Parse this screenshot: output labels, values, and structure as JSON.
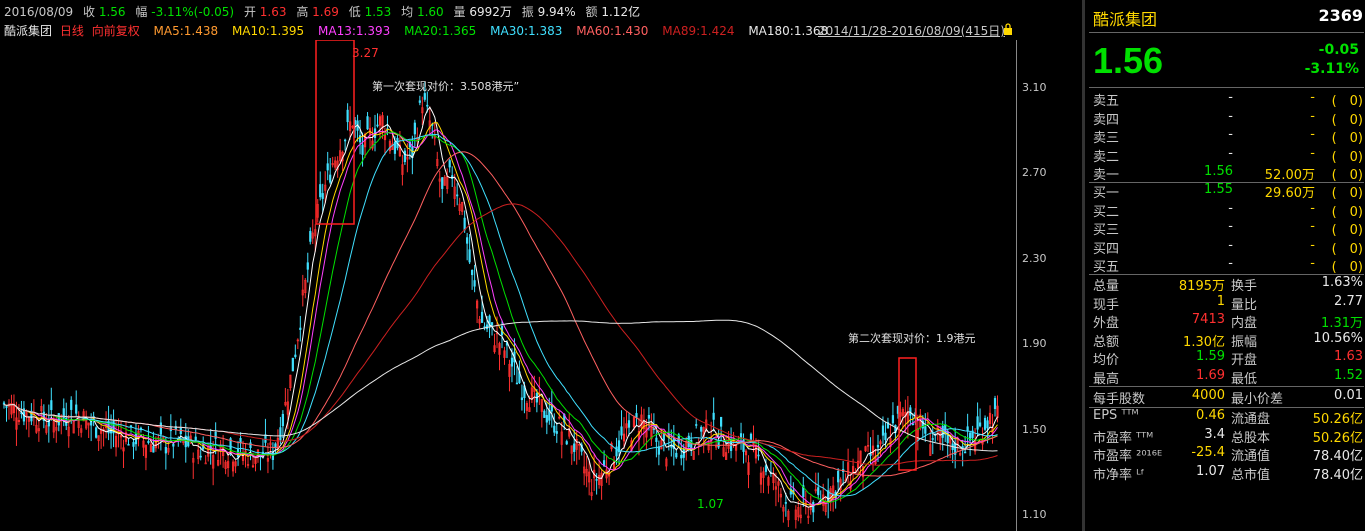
{
  "header": {
    "date": "2016/08/09",
    "close_label": "收",
    "close": "1.56",
    "change_label": "幅",
    "change": "-3.11%(-0.05)",
    "open_label": "开",
    "open": "1.63",
    "high_label": "高",
    "high": "1.69",
    "low_label": "低",
    "low": "1.53",
    "avg_label": "均",
    "avg": "1.60",
    "volume_label": "量",
    "volume": "6992万",
    "amplitude_label": "振",
    "amplitude": "9.94%",
    "amount_label": "额",
    "amount": "1.12亿"
  },
  "ma_row": {
    "name": "酷派集团",
    "period": "日线",
    "adjust": "向前复权",
    "ma5": "MA5:1.438",
    "ma10": "MA10:1.395",
    "ma13": "MA13:1.393",
    "ma20": "MA20:1.365",
    "ma30": "MA30:1.383",
    "ma60": "MA60:1.430",
    "ma89": "MA89:1.424",
    "ma180": "MA180:1.368",
    "range": "2014/11/28-2016/08/09(415日)"
  },
  "colors": {
    "up": "#ff3030",
    "down": "#00e000",
    "ma5": "#ffffff",
    "ma10": "#ffd800",
    "ma13": "#ff40ff",
    "ma20": "#00e000",
    "ma30": "#40e0ff",
    "ma60": "#ff6060",
    "ma89": "#cc2020",
    "ma180": "#e8e8e8",
    "box": "#ff2020"
  },
  "annotations": {
    "peak": "3.27",
    "low": "1.07",
    "first_sale": "第一次套现对价：3.508港元”",
    "second_sale": "第二次套现对价：1.9港元"
  },
  "chart_data": {
    "type": "candlestick",
    "ylim": [
      1.05,
      3.3
    ],
    "y_ticks": [
      "3.10",
      "2.70",
      "2.30",
      "1.90",
      "1.50",
      "1.10"
    ],
    "y_tick_values": [
      3.1,
      2.7,
      2.3,
      1.9,
      1.5,
      1.1
    ],
    "x_range": [
      "2014/11/28",
      "2016/08/09"
    ],
    "close_series": [
      1.62,
      1.6,
      1.58,
      1.57,
      1.55,
      1.54,
      1.56,
      1.58,
      1.55,
      1.52,
      1.5,
      1.48,
      1.47,
      1.46,
      1.45,
      1.44,
      1.43,
      1.45,
      1.44,
      1.42,
      1.4,
      1.42,
      1.41,
      1.4,
      1.39,
      1.38,
      1.38,
      1.4,
      1.55,
      1.8,
      2.1,
      2.4,
      2.6,
      2.75,
      2.85,
      2.95,
      2.8,
      2.9,
      2.95,
      2.85,
      2.75,
      2.8,
      3.05,
      2.9,
      2.6,
      2.7,
      2.55,
      2.2,
      2.0,
      1.95,
      1.9,
      1.8,
      1.7,
      1.65,
      1.6,
      1.55,
      1.5,
      1.45,
      1.35,
      1.25,
      1.3,
      1.38,
      1.45,
      1.5,
      1.55,
      1.48,
      1.42,
      1.4,
      1.42,
      1.45,
      1.48,
      1.5,
      1.46,
      1.44,
      1.42,
      1.4,
      1.35,
      1.28,
      1.2,
      1.15,
      1.12,
      1.15,
      1.18,
      1.22,
      1.25,
      1.3,
      1.35,
      1.38,
      1.4,
      1.5,
      1.55,
      1.6,
      1.52,
      1.48,
      1.45,
      1.42,
      1.43,
      1.45,
      1.5,
      1.56
    ]
  },
  "panel": {
    "name": "酷派集团",
    "code": "2369",
    "price": "1.56",
    "change": "-0.05",
    "change_pct": "-3.11%",
    "asks": [
      {
        "label": "卖五",
        "price": "-",
        "vol": "-",
        "broker": "(　0)"
      },
      {
        "label": "卖四",
        "price": "-",
        "vol": "-",
        "broker": "(　0)"
      },
      {
        "label": "卖三",
        "price": "-",
        "vol": "-",
        "broker": "(　0)"
      },
      {
        "label": "卖二",
        "price": "-",
        "vol": "-",
        "broker": "(　0)"
      },
      {
        "label": "卖一",
        "price": "1.56",
        "vol": "52.00万",
        "broker": "(　0)"
      }
    ],
    "bids": [
      {
        "label": "买一",
        "price": "1.55",
        "vol": "29.60万",
        "broker": "(　0)"
      },
      {
        "label": "买二",
        "price": "-",
        "vol": "-",
        "broker": "(　0)"
      },
      {
        "label": "买三",
        "price": "-",
        "vol": "-",
        "broker": "(　0)"
      },
      {
        "label": "买四",
        "price": "-",
        "vol": "-",
        "broker": "(　0)"
      },
      {
        "label": "买五",
        "price": "-",
        "vol": "-",
        "broker": "(　0)"
      }
    ],
    "stats1": [
      {
        "k1": "总量",
        "v1": "8195万",
        "c1": "c-yellow",
        "k2": "换手",
        "v2": "1.63%",
        "c2": "c-white"
      },
      {
        "k1": "现手",
        "v1": "1",
        "c1": "c-yellow",
        "k2": "量比",
        "v2": "2.77",
        "c2": "c-white"
      },
      {
        "k1": "外盘",
        "v1": "7413",
        "c1": "c-red",
        "k2": "内盘",
        "v2": "1.31万",
        "c2": "c-green"
      },
      {
        "k1": "总额",
        "v1": "1.30亿",
        "c1": "c-yellow",
        "k2": "振幅",
        "v2": "10.56%",
        "c2": "c-white"
      },
      {
        "k1": "均价",
        "v1": "1.59",
        "c1": "c-green",
        "k2": "开盘",
        "v2": "1.63",
        "c2": "c-red"
      },
      {
        "k1": "最高",
        "v1": "1.69",
        "c1": "c-red",
        "k2": "最低",
        "v2": "1.52",
        "c2": "c-green"
      }
    ],
    "lot": {
      "k1": "每手股数",
      "v1": "4000",
      "k2": "最小价差",
      "v2": "0.01"
    },
    "stats2": [
      {
        "k1": "EPS ᵀᵀᴹ",
        "v1": "0.46",
        "c1": "c-yellow",
        "k2": "流通盘",
        "v2": "50.26亿",
        "c2": "c-yellow"
      },
      {
        "k1": "市盈率 ᵀᵀᴹ",
        "v1": "3.4",
        "c1": "c-white",
        "k2": "总股本",
        "v2": "50.26亿",
        "c2": "c-yellow"
      },
      {
        "k1": "市盈率 ²⁰¹⁶ᴱ",
        "v1": "-25.4",
        "c1": "c-yellow",
        "k2": "流通值",
        "v2": "78.40亿",
        "c2": "c-white"
      },
      {
        "k1": "市净率 ᴸᶠ",
        "v1": "1.07",
        "c1": "c-white",
        "k2": "总市值",
        "v2": "78.40亿",
        "c2": "c-white"
      }
    ]
  }
}
